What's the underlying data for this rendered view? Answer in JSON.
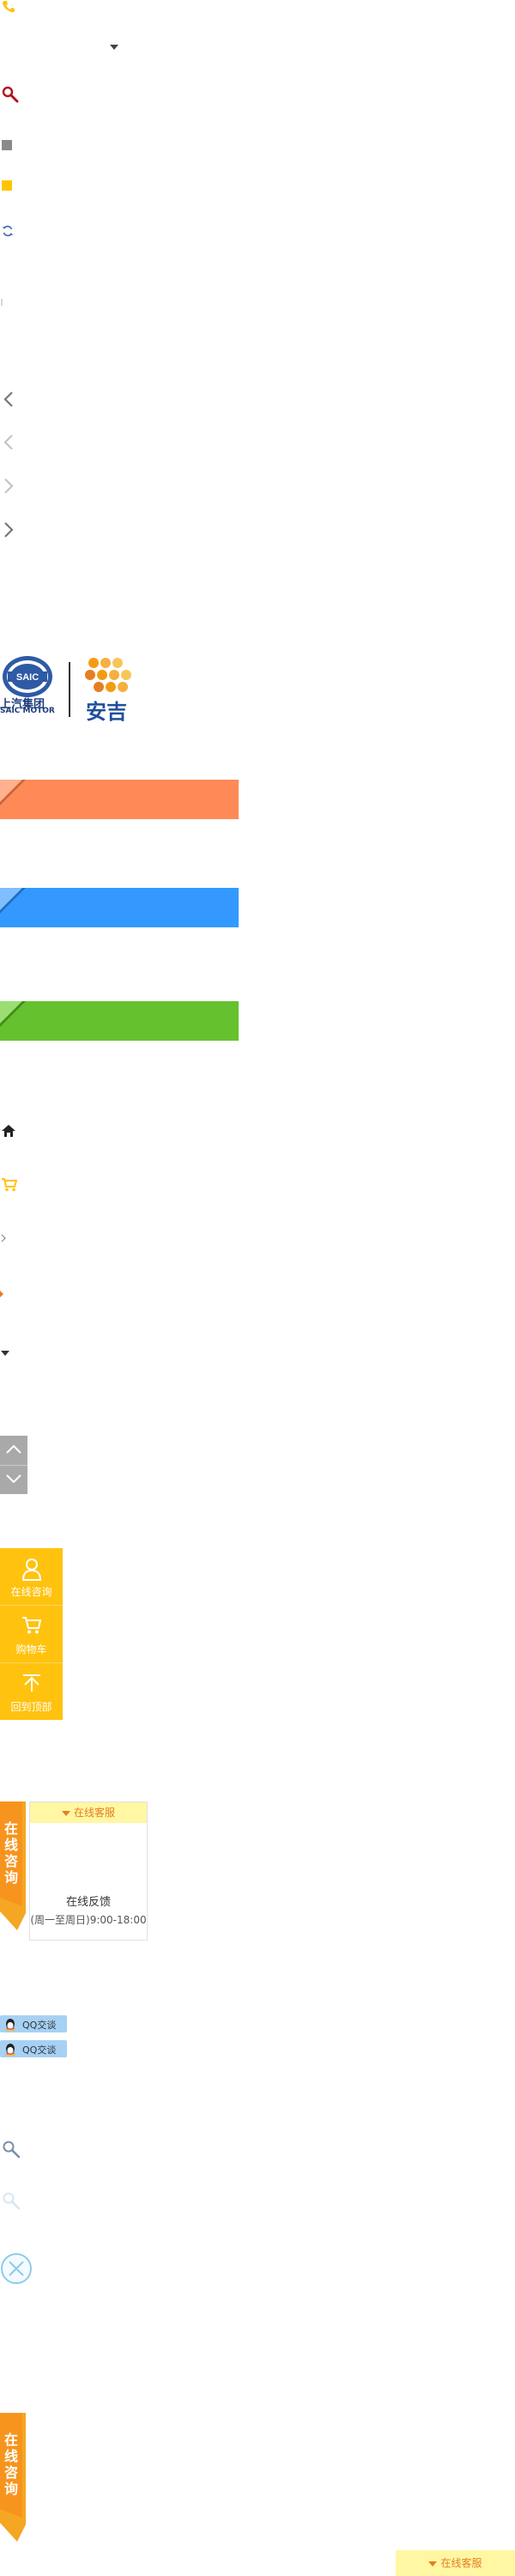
{
  "icons": {
    "phone": "phone-icon",
    "dropdown": "caret-down-icon",
    "search": "search-icon",
    "refresh": "refresh-icon",
    "home": "home-icon",
    "cart": "cart-icon",
    "close": "close-icon"
  },
  "colors": {
    "banner_orange": "#ff8a57",
    "banner_blue": "#3399ff",
    "banner_green": "#66c12e",
    "sidebar_yellow": "#ffc20e",
    "panel_header": "#fff7a3",
    "accent_orange": "#e67e22",
    "qq_blue": "#a6d1f5",
    "scroll_gray": "#a9a9a9"
  },
  "logo": {
    "saic_badge": "SAIC",
    "saic_cn": "上汽集团",
    "saic_en": "SAIC MOTOR",
    "anji": "安吉"
  },
  "sidebar": {
    "items": [
      {
        "label": "在线咨询",
        "icon": "user-icon"
      },
      {
        "label": "购物车",
        "icon": "cart-icon"
      },
      {
        "label": "回到顶部",
        "icon": "back-to-top-icon"
      }
    ]
  },
  "consult": {
    "vertical_label": "在线咨询",
    "header": "在线客服",
    "title": "在线反馈",
    "hours": "(周一至周日)9:00-18:00",
    "qq_buttons": [
      "QQ交谈",
      "QQ交谈"
    ]
  },
  "bottom": {
    "vertical_label": "在线咨询",
    "header": "在线客服"
  }
}
